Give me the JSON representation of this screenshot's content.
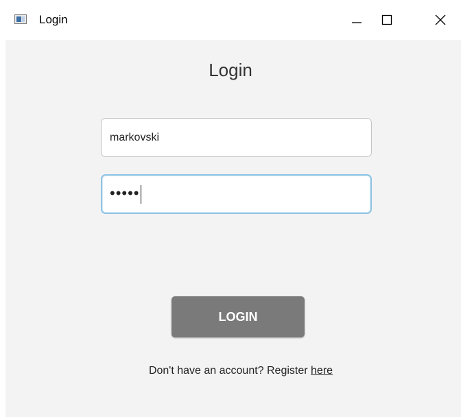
{
  "window": {
    "icon": "app-window-icon",
    "title": "Login",
    "controls": {
      "minimize": "minimize-icon",
      "maximize": "maximize-icon",
      "close": "close-icon"
    }
  },
  "form": {
    "heading": "Login",
    "username_value": "markovski",
    "password_mask": "•••••",
    "login_label": "LOGIN",
    "register_prompt": "Don't have an account? Register",
    "register_link": "here"
  },
  "colors": {
    "content_bg": "#f3f3f3",
    "button_bg": "#7a7a7a",
    "focus_border": "#90c4e4"
  }
}
